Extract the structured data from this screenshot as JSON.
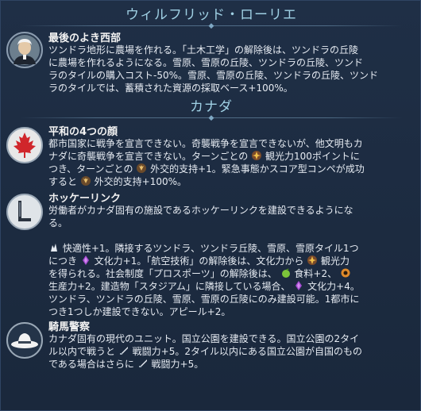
{
  "sections": [
    {
      "title": "ウィルフリッド・ローリエ",
      "items": [
        {
          "heading": "最後のよき西部",
          "icon": "laurier-portrait-icon",
          "lines": [
            "ツンドラ地形に農場を作れる。「土木工学」の解除後は、ツンドラの丘陵",
            "に農場を作れるようになる。雪原、雪原の丘陵、ツンドラの丘陵、ツンド",
            "ラのタイルの購入コスト-50%。雪原、雪原の丘陵、ツンドラの丘陵、ツンド",
            "ラのタイルでは、蓄積された資源の採取ベース+100%。"
          ]
        }
      ]
    },
    {
      "title": "カナダ",
      "items": [
        {
          "heading": "平和の4つの顔",
          "icon": "maple-leaf-icon",
          "lines": [
            "都市国家に戦争を宣言できない。奇襲戦争を宣言できないが、他文明もカ",
            "ナダに奇襲戦争を宣言できない。ターンごとの",
            "観光力100ポイントに",
            "つき、ターンごとの",
            "外交的支持+1。緊急事態かスコア型コンペが成功",
            "すると",
            "外交的支持+100%。"
          ]
        },
        {
          "heading": "ホッケーリンク",
          "icon": "hockey-rink-icon",
          "lines": [
            "労働者がカナダ固有の施設であるホッケーリンクを建設できるようにな",
            "る。",
            "快適性+1。隣接するツンドラ、ツンドラ丘陵、雪原、雪原タイル1つ",
            "につき",
            "文化力+1。「航空技術」の解除後は、文化力から",
            "観光力",
            "を得られる。社会制度「プロスポーツ」の解除後は、",
            "食料+2、",
            "生産力+2。建造物「スタジアム」に隣接している場合、",
            "文化力+4。",
            "ツンドラ、ツンドラの丘陵、雪原、雪原の丘陵にのみ建設可能。1都市に",
            "つき1つしか建設できない。アピール+2。"
          ]
        },
        {
          "heading": "騎馬警察",
          "icon": "mountie-hat-icon",
          "lines": [
            "カナダ固有の現代のユニット。国立公園を建設できる。国立公園の2タイ",
            "ル以内で戦うと",
            "戦闘力+5。2タイル以内にある国立公園が自国のもの",
            "である場合はさらに",
            "戦闘力+5。"
          ]
        }
      ]
    }
  ],
  "colors": {
    "title": "#9fd0e4",
    "background": "#1b2a3f",
    "text": "#e6ebf2"
  }
}
